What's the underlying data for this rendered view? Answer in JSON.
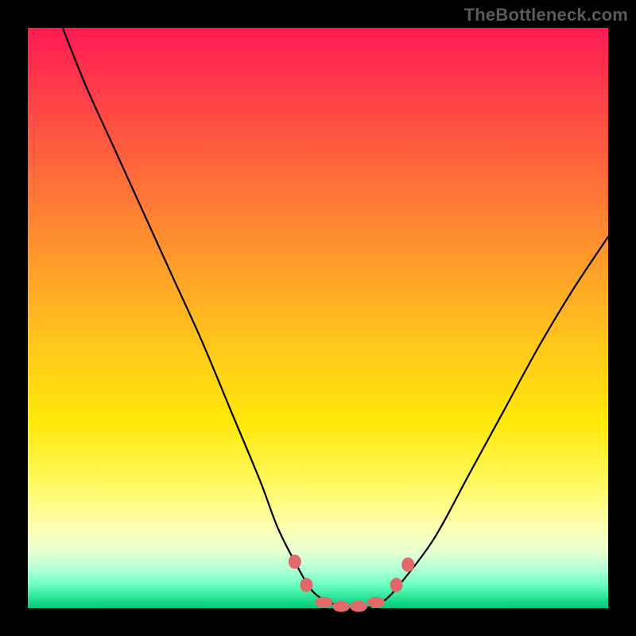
{
  "watermark": "TheBottleneck.com",
  "chart_data": {
    "type": "line",
    "title": "",
    "xlabel": "",
    "ylabel": "",
    "xlim": [
      0,
      100
    ],
    "ylim": [
      0,
      100
    ],
    "grid": false,
    "legend": false,
    "series": [
      {
        "name": "bottleneck-curve",
        "x": [
          6,
          10,
          15,
          20,
          25,
          30,
          35,
          40,
          43,
          46,
          49,
          52,
          55,
          58,
          61,
          64,
          70,
          76,
          82,
          88,
          94,
          100
        ],
        "y": [
          100,
          90,
          79,
          68,
          57,
          46,
          34,
          22,
          14,
          8,
          3,
          1,
          0,
          0,
          1,
          4,
          12,
          23,
          34,
          45,
          55,
          64
        ]
      }
    ],
    "annotations": [
      {
        "name": "marker-left-upper",
        "x": 46.0,
        "y": 8.0
      },
      {
        "name": "marker-left-lower",
        "x": 48.0,
        "y": 4.0
      },
      {
        "name": "marker-trough-1",
        "x": 51.0,
        "y": 1.0
      },
      {
        "name": "marker-trough-2",
        "x": 54.0,
        "y": 0.3
      },
      {
        "name": "marker-trough-3",
        "x": 57.0,
        "y": 0.3
      },
      {
        "name": "marker-trough-4",
        "x": 60.0,
        "y": 1.0
      },
      {
        "name": "marker-right-lower",
        "x": 63.5,
        "y": 4.0
      },
      {
        "name": "marker-right-upper",
        "x": 65.5,
        "y": 7.5
      }
    ],
    "background_gradient": {
      "top": "#ff1a52",
      "mid": "#ffe80a",
      "bottom": "#00c878"
    }
  }
}
